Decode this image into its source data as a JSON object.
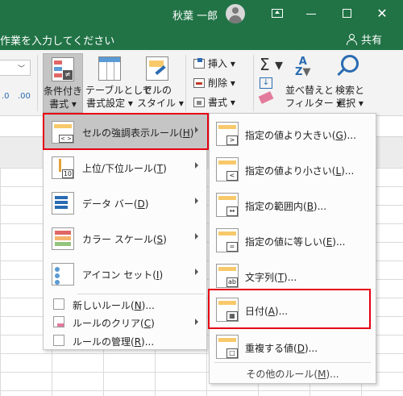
{
  "titlebar": {
    "user_name": "秋葉 一郎",
    "close_glyph": "✕"
  },
  "tellbar": {
    "tell_me_text": "作業を入力してください",
    "share_label": "共有"
  },
  "ribbon": {
    "number_format_value": "",
    "percent_decimals": [
      ".0",
      ".00"
    ],
    "conditional_format": [
      "条件付き",
      "書式 ▾"
    ],
    "table_format": [
      "テーブルとして",
      "書式設定 ▾"
    ],
    "cell_style": [
      "セルの",
      "スタイル ▾"
    ],
    "insert_label": "挿入 ▾",
    "delete_label": "削除 ▾",
    "format_label": "書式 ▾",
    "sort_filter": [
      "並べ替えと",
      "フィルター ▾"
    ],
    "find_select": [
      "検索と",
      "選択 ▾"
    ],
    "autosum_glyph": "Σ ▾"
  },
  "cf_menu": {
    "items": [
      {
        "label": "セルの強調表示ルール",
        "key": "H",
        "has_submenu": true
      },
      {
        "label": "上位/下位ルール",
        "key": "T",
        "has_submenu": true
      },
      {
        "label": "データ バー",
        "key": "D",
        "has_submenu": true
      },
      {
        "label": "カラー スケール",
        "key": "S",
        "has_submenu": true
      },
      {
        "label": "アイコン セット",
        "key": "I",
        "has_submenu": true
      }
    ],
    "small_items": [
      {
        "label": "新しいルール(",
        "key": "N",
        "suffix": ")..."
      },
      {
        "label": "ルールのクリア(",
        "key": "C",
        "suffix": ")"
      },
      {
        "label": "ルールの管理(",
        "key": "R",
        "suffix": ")..."
      }
    ]
  },
  "sub_menu": {
    "items": [
      {
        "label": "指定の値より大きい(",
        "key": "G",
        "suffix": ")...",
        "tag": ">"
      },
      {
        "label": "指定の値より小さい(",
        "key": "L",
        "suffix": ")...",
        "tag": "<"
      },
      {
        "label": "指定の範囲内(",
        "key": "B",
        "suffix": ")...",
        "tag": "↔"
      },
      {
        "label": "指定の値に等しい(",
        "key": "E",
        "suffix": ")...",
        "tag": "="
      },
      {
        "label": "文字列(",
        "key": "T",
        "suffix": ")...",
        "tag": "ab"
      },
      {
        "label": "日付(",
        "key": "A",
        "suffix": ")...",
        "tag": "▦"
      },
      {
        "label": "重複する値(",
        "key": "D",
        "suffix": ")...",
        "tag": "□"
      }
    ],
    "more_rules": {
      "label": "その他のルール(",
      "key": "M",
      "suffix": ")..."
    }
  }
}
